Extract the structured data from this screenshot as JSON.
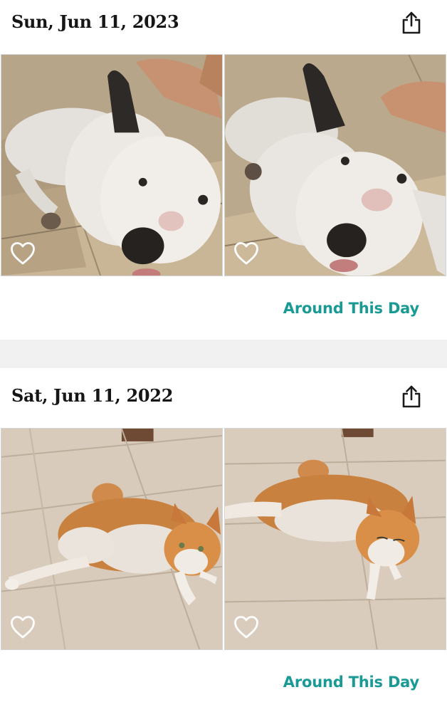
{
  "memories": [
    {
      "date": "Sun, Jun 11, 2023",
      "subject": "dog",
      "photos": [
        {
          "subject": "white dog being petted"
        },
        {
          "subject": "white dog being petted"
        }
      ],
      "around_label": "Around This Day"
    },
    {
      "date": "Sat, Jun 11, 2022",
      "subject": "cat",
      "photos": [
        {
          "subject": "orange and white cat lying on tiles"
        },
        {
          "subject": "orange and white cat lying on tiles"
        }
      ],
      "around_label": "Around This Day"
    }
  ],
  "icons": {
    "share": "share-icon",
    "favorite": "heart-outline-icon"
  },
  "colors": {
    "accent": "#1a9a95",
    "divider": "#f1f1f1",
    "text": "#161616"
  }
}
